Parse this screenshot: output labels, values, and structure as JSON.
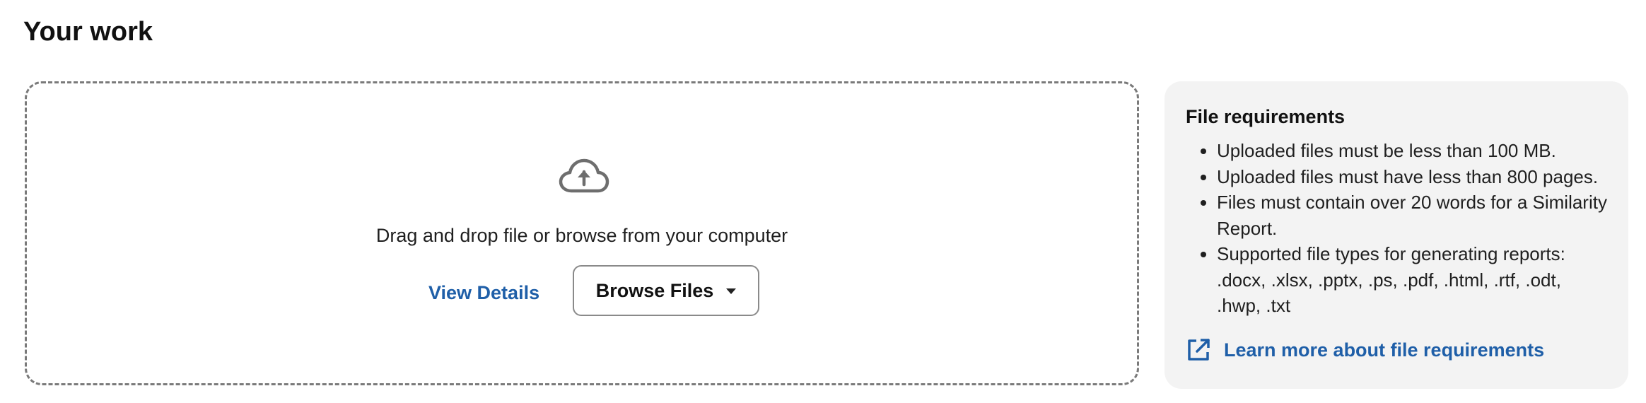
{
  "page": {
    "title": "Your work"
  },
  "upload": {
    "icon": "cloud-upload-icon",
    "instruction": "Drag and drop file or browse from your computer",
    "view_details_label": "View Details",
    "browse_label": "Browse Files",
    "browse_icon": "caret-down-icon"
  },
  "requirements": {
    "title": "File requirements",
    "items": [
      "Uploaded files must be less than 100 MB.",
      "Uploaded files must have less than 800 pages.",
      "Files must contain over 20 words for a Similarity Report.",
      "Supported file types for generating reports: .docx, .xlsx, .pptx, .ps, .pdf, .html, .rtf, .odt, .hwp, .txt"
    ],
    "learn_more_label": "Learn more about file requirements",
    "learn_more_icon": "external-link-icon"
  },
  "colors": {
    "link": "#1f5fa8",
    "panel_background": "#f3f3f3",
    "dropzone_border": "#7a7a7a"
  }
}
